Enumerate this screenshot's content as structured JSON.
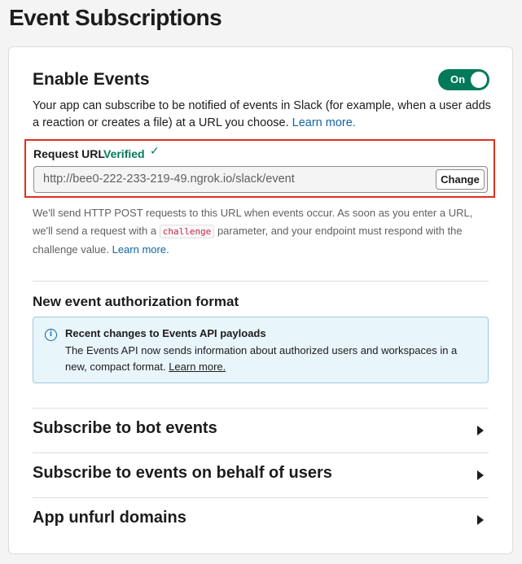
{
  "page": {
    "title": "Event Subscriptions"
  },
  "enable_events": {
    "title": "Enable Events",
    "toggle_label": "On",
    "description": "Your app can subscribe to be notified of events in Slack (for example, when a user adds a reaction or creates a file) at a URL you choose.",
    "learn_more": "Learn more."
  },
  "request_url": {
    "label": "Request URL",
    "status": "Verified",
    "check": "✓",
    "value": "http://bee0-222-233-219-49.ngrok.io/slack/event",
    "change_label": "Change",
    "help_before": "We'll send HTTP POST requests to this URL when events occur. As soon as you enter a URL, we'll send a request with a",
    "help_code": "challenge",
    "help_after": "parameter, and your endpoint must respond with the challenge value.",
    "help_link": "Learn more."
  },
  "auth_format": {
    "title": "New event authorization format",
    "info_heading": "Recent changes to Events API payloads",
    "info_body": "The Events API now sends information about authorized users and workspaces in a new, compact format.",
    "info_link": "Learn more.",
    "info_icon": "info-icon"
  },
  "sections": [
    {
      "label": "Subscribe to bot events"
    },
    {
      "label": "Subscribe to events on behalf of users"
    },
    {
      "label": "App unfurl domains"
    }
  ],
  "colors": {
    "accent_green": "#007a5a",
    "link_blue": "#1264a3",
    "highlight_red": "#e0301e",
    "info_bg": "#e8f5fa"
  }
}
